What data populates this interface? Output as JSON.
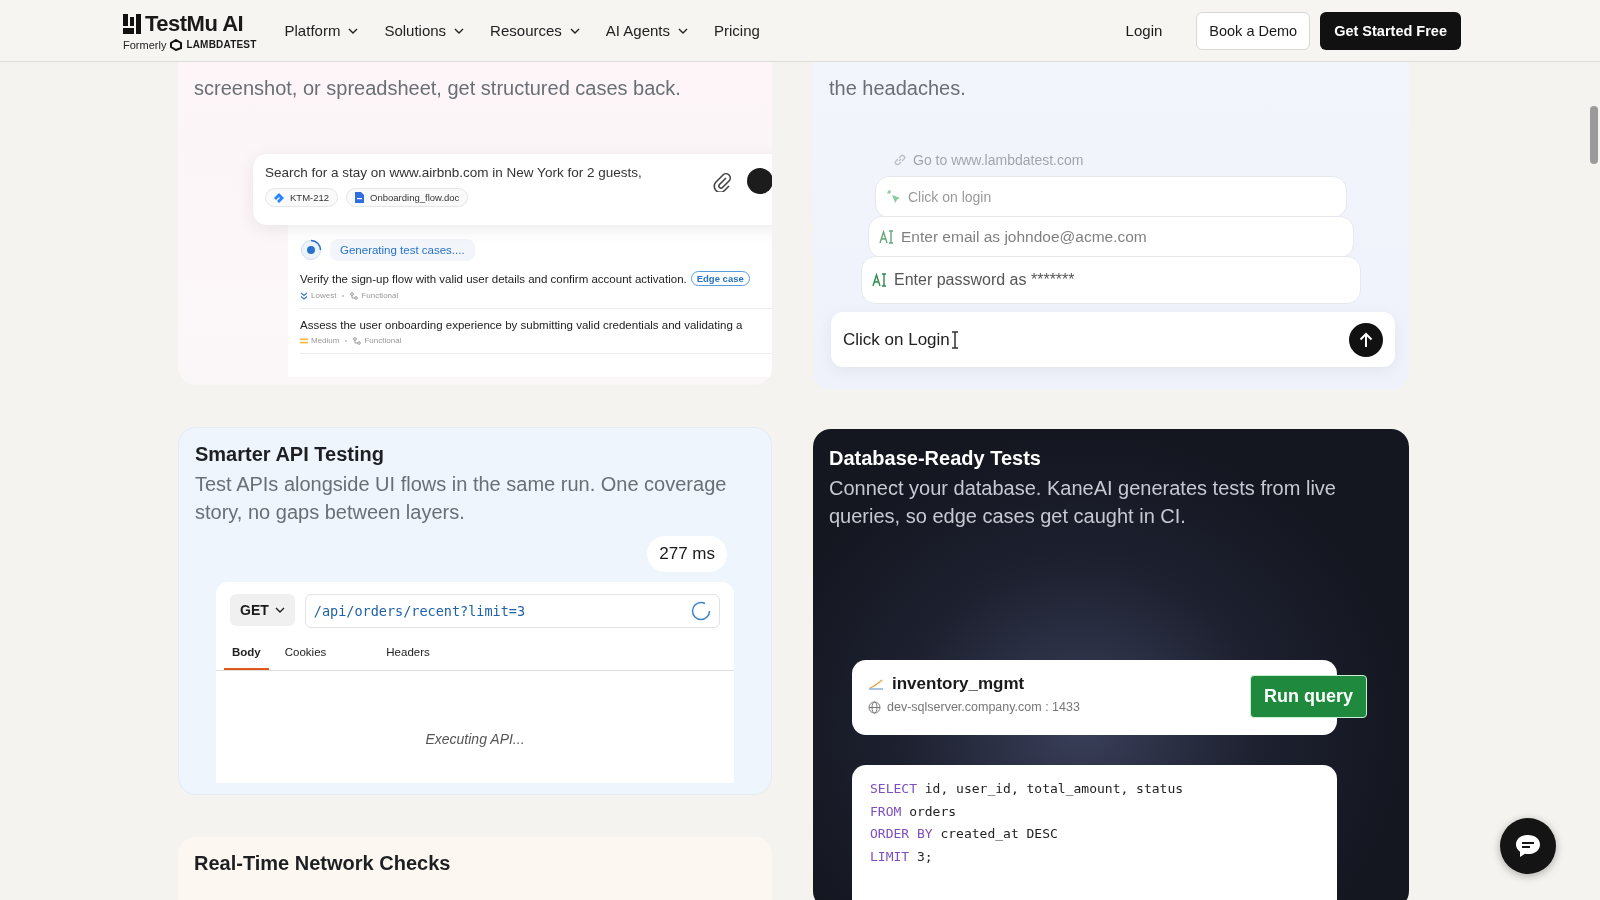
{
  "header": {
    "logo": {
      "name": "TestMu AI",
      "formerly": "Formerly",
      "former_brand": "LAMBDATEST"
    },
    "menu": [
      {
        "label": "Platform",
        "dropdown": true
      },
      {
        "label": "Solutions",
        "dropdown": true
      },
      {
        "label": "Resources",
        "dropdown": true
      },
      {
        "label": "AI Agents",
        "dropdown": true
      },
      {
        "label": "Pricing",
        "dropdown": false
      }
    ],
    "login": "Login",
    "demo": "Book a Demo",
    "cta": "Get Started Free"
  },
  "cards": [
    {
      "kind": "test-cases",
      "description": "screenshot, or spreadsheet, get structured cases back.",
      "prompt": "Search for a stay on www.airbnb.com in New York for 2 guests,",
      "chips": [
        {
          "kind": "ticket",
          "label": "KTM-212"
        },
        {
          "kind": "doc",
          "label": "Onboarding_flow.doc"
        }
      ],
      "status": "Generating test cases....",
      "cases": [
        {
          "title": "Verify the sign-up flow with valid user details and confirm account activation.",
          "tag": "Edge case",
          "priority": "Lowest",
          "type": "Functional"
        },
        {
          "title": "Assess the user onboarding experience by submitting valid credentials and validating a",
          "priority": "Medium",
          "type": "Functional"
        }
      ]
    },
    {
      "kind": "codeless",
      "description": "the headaches.",
      "steps": [
        {
          "kind": "link",
          "text": "Go to www.lambdatest.com"
        },
        {
          "kind": "click",
          "text": "Click on login"
        },
        {
          "kind": "type",
          "text": "Enter email as johndoe@acme.com"
        },
        {
          "kind": "type",
          "text": "Enter password as *******"
        }
      ],
      "input": "Click on Login"
    },
    {
      "kind": "api",
      "title": "Smarter API Testing",
      "description": "Test APIs alongside UI flows in the same run. One coverage story, no gaps between layers.",
      "timing": "277 ms",
      "method": "GET",
      "url": "/api/orders/recent?limit=3",
      "tabs": [
        {
          "label": "Body",
          "selected": true
        },
        {
          "label": "Cookies",
          "selected": false
        },
        {
          "label": "Headers",
          "selected": false
        }
      ],
      "body": "Executing API..."
    },
    {
      "kind": "database",
      "title": "Database-Ready Tests",
      "description": "Connect your database. KaneAI generates tests from live queries, so edge cases get caught in CI.",
      "db": "inventory_mgmt",
      "host": "dev-sqlserver.company.com : 1433",
      "button": "Run query",
      "sql": [
        {
          "keyword": "SELECT",
          "rest": "id, user_id, total_amount, status"
        },
        {
          "keyword": "FROM",
          "rest": "orders"
        },
        {
          "keyword": "ORDER BY",
          "rest": "created_at DESC"
        },
        {
          "keyword": "LIMIT",
          "rest": "3;"
        }
      ]
    },
    {
      "kind": "network",
      "title": "Real-Time Network Checks"
    }
  ]
}
